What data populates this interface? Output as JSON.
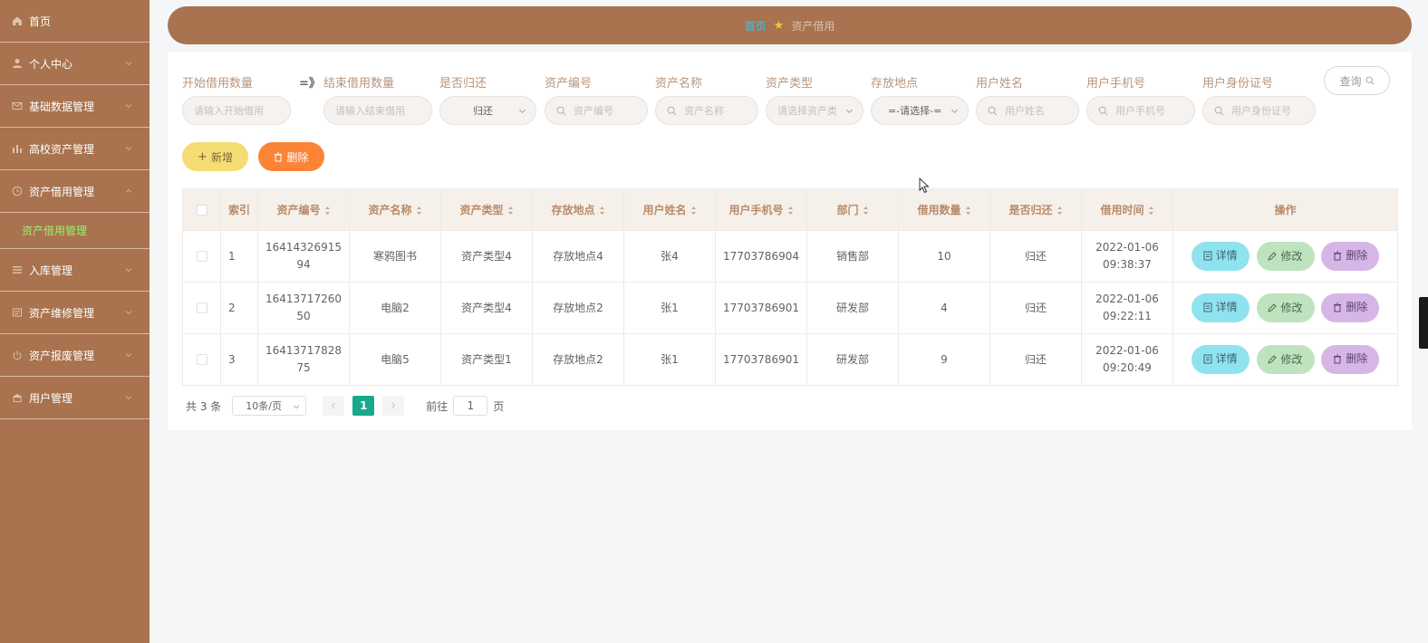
{
  "sidebar": {
    "items": [
      {
        "label": "首页",
        "icon": "home-icon"
      },
      {
        "label": "个人中心",
        "icon": "user-icon"
      },
      {
        "label": "基础数据管理",
        "icon": "mail-icon"
      },
      {
        "label": "高校资产管理",
        "icon": "chart-icon"
      },
      {
        "label": "资产借用管理",
        "icon": "clock-icon",
        "sub": "资产借用管理"
      },
      {
        "label": "入库管理",
        "icon": "list-icon"
      },
      {
        "label": "资产维修管理",
        "icon": "document-icon"
      },
      {
        "label": "资产报废管理",
        "icon": "power-icon"
      },
      {
        "label": "用户管理",
        "icon": "building-icon"
      }
    ],
    "active_color": "#9cef6f"
  },
  "breadcrumb": {
    "home": "首页",
    "current": "资产借用"
  },
  "search": {
    "labels": {
      "start_qty": "开始借用数量",
      "end_qty": "结束借用数量",
      "returned": "是否归还",
      "asset_no": "资产编号",
      "asset_name": "资产名称",
      "asset_type": "资产类型",
      "location": "存放地点",
      "user_name": "用户姓名",
      "user_phone": "用户手机号",
      "user_id": "用户身份证号"
    },
    "range_sep": "=》",
    "placeholders": {
      "start_qty": "请输入开始借用",
      "end_qty": "请输入结束借用",
      "asset_no": "资产编号",
      "asset_name": "资产名称",
      "asset_type": "请选择资产类",
      "user_name": "用户姓名",
      "user_phone": "用户手机号",
      "user_id": "用户身份证号"
    },
    "returned_value": "归还",
    "location_value": "=-请选择-=",
    "query_label": "查询"
  },
  "actions": {
    "add": "新增",
    "delete": "删除"
  },
  "table": {
    "headers": {
      "index": "索引",
      "asset_no": "资产编号",
      "asset_name": "资产名称",
      "asset_type": "资产类型",
      "location": "存放地点",
      "user_name": "用户姓名",
      "user_phone": "用户手机号",
      "dept": "部门",
      "qty": "借用数量",
      "returned": "是否归还",
      "time": "借用时间",
      "ops": "操作"
    },
    "rows": [
      {
        "index": "1",
        "asset_no": "1641432691594",
        "asset_name": "寒鸦图书",
        "asset_type": "资产类型4",
        "location": "存放地点4",
        "user_name": "张4",
        "user_phone": "17703786904",
        "dept": "销售部",
        "qty": "10",
        "returned": "归还",
        "time": "2022-01-06 09:38:37"
      },
      {
        "index": "2",
        "asset_no": "1641371726050",
        "asset_name": "电脑2",
        "asset_type": "资产类型4",
        "location": "存放地点2",
        "user_name": "张1",
        "user_phone": "17703786901",
        "dept": "研发部",
        "qty": "4",
        "returned": "归还",
        "time": "2022-01-06 09:22:11"
      },
      {
        "index": "3",
        "asset_no": "1641371782875",
        "asset_name": "电脑5",
        "asset_type": "资产类型1",
        "location": "存放地点2",
        "user_name": "张1",
        "user_phone": "17703786901",
        "dept": "研发部",
        "qty": "9",
        "returned": "归还",
        "time": "2022-01-06 09:20:49"
      }
    ],
    "op_labels": {
      "detail": "详情",
      "edit": "修改",
      "delete": "删除"
    }
  },
  "pagination": {
    "total": "共 3 条",
    "page_size": "10条/页",
    "current_page": "1",
    "goto_prefix": "前往",
    "goto_value": "1",
    "goto_suffix": "页"
  },
  "colors": {
    "theme": "#a8734e",
    "page_active": "#17a98c",
    "add": "#f5dc73",
    "delete": "#fb8437"
  }
}
